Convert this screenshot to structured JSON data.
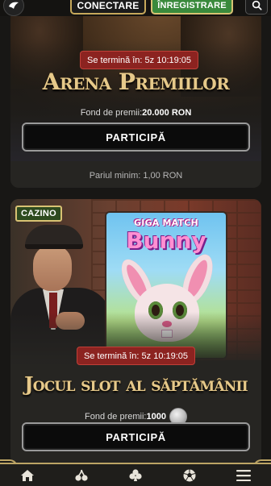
{
  "header": {
    "login_label": "CONECTARE",
    "register_label": "ÎNREGISTRARE"
  },
  "tournaments": [
    {
      "timer": "Se termină în: 5z 10:19:05",
      "title": "Arena Premiilor",
      "fund_label": "Fond de premii:",
      "fund_value": "20.000 RON",
      "button_label": "PARTICIPĂ",
      "min_bet": "Pariul minim: 1,00 RON"
    },
    {
      "tag": "CAZINO",
      "timer": "Se termină în: 5z 10:19:05",
      "title": "Jocul slot al săptămânii",
      "fund_label": "Fond de premii:",
      "fund_value": "1000",
      "button_label": "PARTICIPĂ",
      "game_logo_line1": "GIGA MATCH",
      "game_logo_line2": "Bunny"
    }
  ],
  "bottom_nav": {
    "items": [
      "home-icon",
      "cherries-icon",
      "club-icon",
      "soccer-ball-icon",
      "menu-icon"
    ]
  },
  "colors": {
    "accent_gold": "#bda565",
    "timer_red": "#8c2320",
    "register_green": "#3a8a3c",
    "title_gold": "#e6c98a"
  }
}
